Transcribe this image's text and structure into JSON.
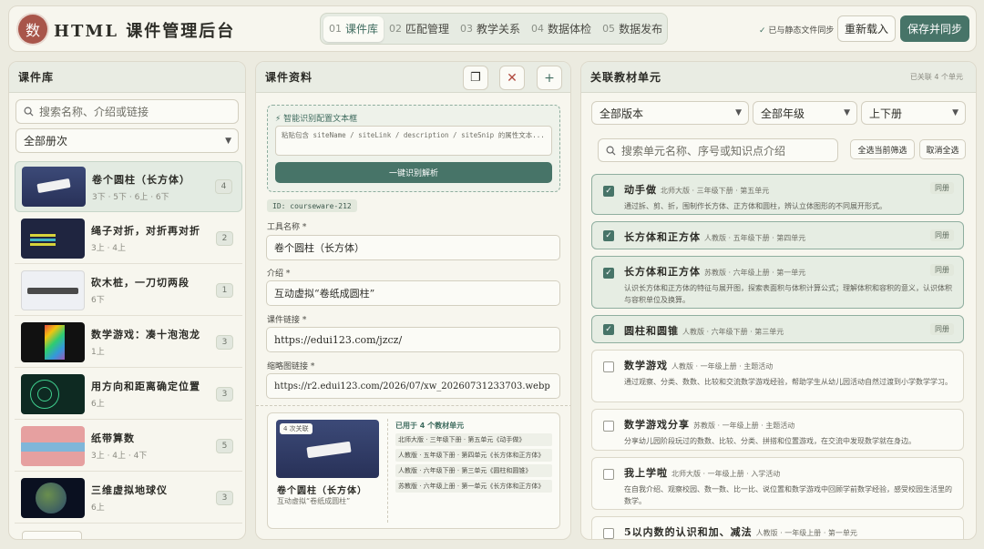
{
  "app": {
    "logo_char": "数",
    "title": "HTML 课件管理后台"
  },
  "tabs": [
    {
      "num": "01",
      "label": "课件库"
    },
    {
      "num": "02",
      "label": "匹配管理"
    },
    {
      "num": "03",
      "label": "教学关系"
    },
    {
      "num": "04",
      "label": "数据体检"
    },
    {
      "num": "05",
      "label": "数据发布"
    }
  ],
  "header": {
    "sync_check": "✓",
    "sync_status": "已与静态文件同步",
    "reload_label": "重新载入",
    "save_label": "保存并同步"
  },
  "library": {
    "title": "课件库",
    "search_placeholder": "搜索名称、介绍或链接",
    "filter": "全部册次",
    "items": [
      {
        "name": "卷个圆柱（长方体）",
        "meta": "3下 · 5下 · 6上 · 6下",
        "count": "4"
      },
      {
        "name": "绳子对折，对折再对折",
        "meta": "3上 · 4上",
        "count": "2"
      },
      {
        "name": "砍木桩，一刀切两段",
        "meta": "6下",
        "count": "1"
      },
      {
        "name": "数学游戏：凑十泡泡龙",
        "meta": "1上",
        "count": "3"
      },
      {
        "name": "用方向和距离确定位置",
        "meta": "6上",
        "count": "3"
      },
      {
        "name": "纸带算数",
        "meta": "3上 · 4上 · 4下",
        "count": "5"
      },
      {
        "name": "三维虚拟地球仪",
        "meta": "6上",
        "count": "3"
      }
    ]
  },
  "editor": {
    "title": "课件资料",
    "copy_icon": "❐",
    "close_icon": "✕",
    "add_icon": "+",
    "smart_title": "⚡ 智能识别配置文本框",
    "smart_placeholder": "粘贴包含 siteName / siteLink / description / siteSnip 的属性文本...",
    "parse_button": "一键识别解析",
    "id_tag": "ID: courseware-212",
    "name_label": "工具名称 *",
    "name_value": "卷个圆柱（长方体）",
    "desc_label": "介绍 *",
    "desc_value": "互动虚拟“卷纸成圆柱”",
    "link_label": "课件链接 *",
    "link_value": "https://edui123.com/jzcz/",
    "thumb_label": "缩略图链接 *",
    "thumb_value": "https://r2.edui123.com/2026/07/xw_20260731233703.webp",
    "preview": {
      "badge": "4 次关联",
      "name": "卷个圆柱（长方体）",
      "desc": "互动虚拟“卷纸成圆柱”",
      "used_title": "已用于 4 个教材单元",
      "used": [
        "北师大版 · 三年级下册 · 第五单元《动手做》",
        "人教版 · 五年级下册 · 第四单元《长方体和正方体》",
        "人教版 · 六年级下册 · 第三单元《圆柱和圆锥》",
        "苏教版 · 六年级上册 · 第一单元《长方体和正方体》"
      ]
    }
  },
  "units": {
    "title": "关联教材单元",
    "count_label": "已关联 4 个单元",
    "version_filter": "全部版本",
    "grade_filter": "全部年级",
    "volume_filter": "上下册",
    "search_placeholder": "搜索单元名称、序号或知识点介绍",
    "select_all": "全选当前筛选",
    "clear_all": "取消全选",
    "checkmark": "✓",
    "list": [
      {
        "name": "动手做",
        "meta": "北师大版 · 三年级下册 · 第五单元",
        "desc": "通过拆、剪、折，围制作长方体、正方体和圆柱，辨认立体图形的不同展开形式。",
        "badge": "同册",
        "checked": true
      },
      {
        "name": "长方体和正方体",
        "meta": "人教版 · 五年级下册 · 第四单元",
        "desc": "",
        "badge": "同册",
        "checked": true
      },
      {
        "name": "长方体和正方体",
        "meta": "苏教版 · 六年级上册 · 第一单元",
        "desc": "认识长方体和正方体的特征与展开图，探索表面积与体积计算公式；理解体积和容积的意义，认识体积与容积单位及换算。",
        "badge": "同册",
        "checked": true
      },
      {
        "name": "圆柱和圆锥",
        "meta": "人教版 · 六年级下册 · 第三单元",
        "desc": "",
        "badge": "同册",
        "checked": true
      },
      {
        "name": "数学游戏",
        "meta": "人教版 · 一年级上册 · 主题活动",
        "desc": "通过观察、分类、数数、比较和交流数学游戏经验，帮助学生从幼儿园活动自然过渡到小学数学学习。",
        "badge": "",
        "checked": false
      },
      {
        "name": "数学游戏分享",
        "meta": "苏教版 · 一年级上册 · 主题活动",
        "desc": "分享幼儿园阶段玩过的数数、比较、分类、拼搭和位置游戏，在交流中发现数学就在身边。",
        "badge": "",
        "checked": false
      },
      {
        "name": "我上学啦",
        "meta": "北师大版 · 一年级上册 · 入学活动",
        "desc": "在自我介绍、观察校园、数一数、比一比、说位置和数学游戏中回顾学前数学经验，感受校园生活里的数学。",
        "badge": "",
        "checked": false
      },
      {
        "name": "5以内数的认识和加、减法",
        "meta": "人教版 · 一年级上册 · 第一单元",
        "desc": "",
        "badge": "",
        "checked": false
      }
    ]
  }
}
